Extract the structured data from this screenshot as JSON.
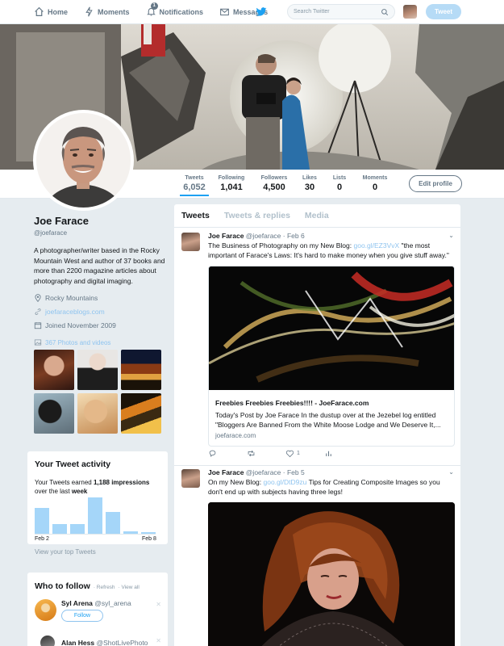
{
  "nav": {
    "home": "Home",
    "moments": "Moments",
    "notifications": "Notifications",
    "notifications_count": "1",
    "messages": "Messages",
    "search_placeholder": "Search Twitter",
    "tweet_button": "Tweet"
  },
  "stats": {
    "tweets_label": "Tweets",
    "tweets": "6,052",
    "following_label": "Following",
    "following": "1,041",
    "followers_label": "Followers",
    "followers": "4,500",
    "likes_label": "Likes",
    "likes": "30",
    "lists_label": "Lists",
    "lists": "0",
    "moments_label": "Moments",
    "moments": "0",
    "edit_profile": "Edit profile"
  },
  "profile": {
    "name": "Joe Farace",
    "handle": "@joefarace",
    "bio": "A photographer/writer based in the Rocky Mountain West and author of 37 books and more than 2200 magazine articles about photography and digital imaging.",
    "location": "Rocky Mountains",
    "website": "joefaraceblogs.com",
    "joined": "Joined November 2009",
    "photos_videos": "367 Photos and videos"
  },
  "activity": {
    "title": "Your Tweet activity",
    "desc_prefix": "Your Tweets earned ",
    "impressions": "1,188 impressions",
    "desc_mid": " over the last ",
    "period": "week",
    "bars": [
      0.71,
      0.27,
      0.27,
      1.0,
      0.6,
      0.07,
      0.04
    ],
    "start_label": "Feb 2",
    "end_label": "Feb 8",
    "view_top": "View your top Tweets"
  },
  "who_to_follow": {
    "title": "Who to follow",
    "refresh": "· Refresh",
    "view_all": "· View all",
    "suggestions": [
      {
        "name": "Syl Arena",
        "handle": "@syl_arena",
        "follow": "Follow"
      },
      {
        "name": "Alan Hess",
        "handle": "@ShotLivePhoto"
      }
    ]
  },
  "timeline": {
    "tabs": [
      "Tweets",
      "Tweets & replies",
      "Media"
    ],
    "tweets": [
      {
        "name": "Joe Farace",
        "handle": "@joefarace",
        "date": "· Feb 6",
        "text_before": "The Business of Photography on my New Blog: ",
        "link": "goo.gl/EZ3VvX",
        "text_after": " \"the most important of Farace's Laws: It's hard to make money when you give stuff away.\"",
        "card_title": "Freebies Freebies Freebies!!!! - JoeFarace.com",
        "card_desc": "Today's Post by Joe Farace In the dustup over at the Jezebel log entitled \"Bloggers Are Banned From the White Moose Lodge and We Deserve It,...",
        "card_url": "joefarace.com",
        "likes": "1"
      },
      {
        "name": "Joe Farace",
        "handle": "@joefarace",
        "date": "· Feb 5",
        "text_before": "On my New Blog: ",
        "link": "goo.gl/DtD9zu",
        "text_after": " Tips for Creating Composite Images so you don't end up with subjects having three legs!"
      }
    ]
  },
  "colors": {
    "accent": "#1da1f2",
    "bar": "#a5d6f9",
    "background": "#e6ecf0"
  }
}
